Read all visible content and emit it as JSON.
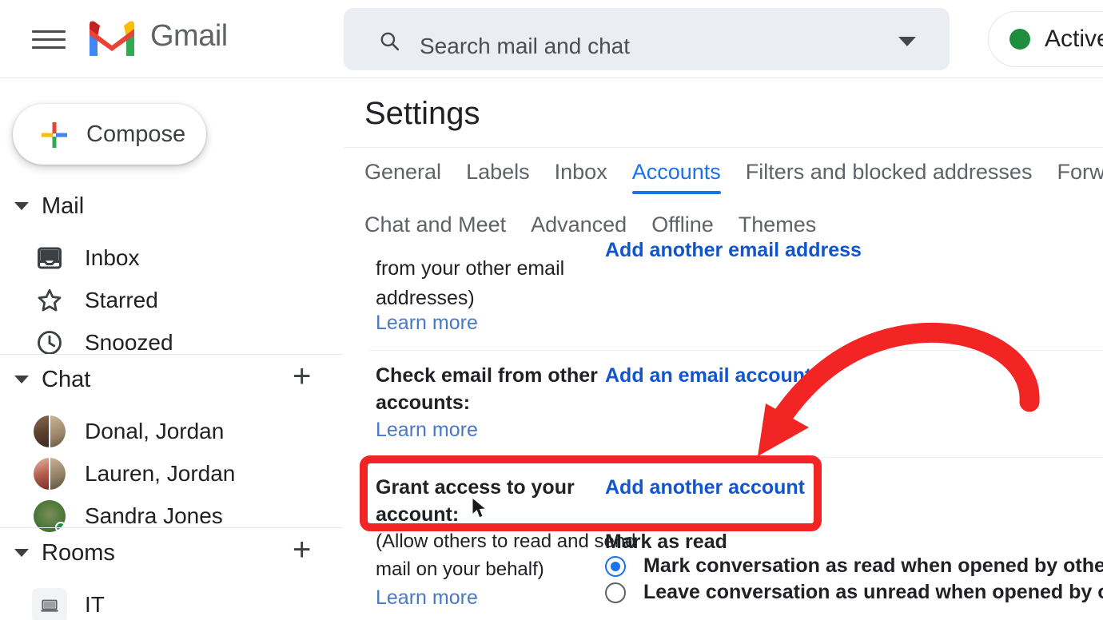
{
  "app": {
    "name": "Gmail"
  },
  "topbar": {
    "menu_icon": "hamburger-menu-icon",
    "logo_icon": "gmail-logo-icon",
    "brand": "Gmail",
    "search": {
      "icon": "search-icon",
      "placeholder": "Search mail and chat",
      "value": "",
      "options_icon": "chevron-down-icon"
    },
    "status": {
      "label": "Active",
      "dot_color": "#1e8e3e",
      "chevron": "chevron-down-icon"
    }
  },
  "sidebar": {
    "compose": {
      "label": "Compose",
      "icon": "plus-icon"
    },
    "groups": [
      {
        "label": "Mail",
        "caret": "caret-down-icon",
        "items": [
          {
            "label": "Inbox",
            "icon": "inbox-icon"
          },
          {
            "label": "Starred",
            "icon": "star-icon"
          },
          {
            "label": "Snoozed",
            "icon": "clock-icon"
          }
        ]
      },
      {
        "label": "Chat",
        "caret": "caret-down-icon",
        "add": "+",
        "items": [
          {
            "label": "Donal, Jordan",
            "icon": "avatar-group"
          },
          {
            "label": "Lauren, Jordan",
            "icon": "avatar-group"
          },
          {
            "label": "Sandra Jones",
            "icon": "avatar"
          }
        ]
      },
      {
        "label": "Rooms",
        "caret": "caret-down-icon",
        "add": "+",
        "items": [
          {
            "label": "IT",
            "icon": "laptop-icon"
          }
        ]
      }
    ]
  },
  "main": {
    "title": "Settings",
    "tabs_row1": [
      {
        "label": "General",
        "active": false
      },
      {
        "label": "Labels",
        "active": false
      },
      {
        "label": "Inbox",
        "active": false
      },
      {
        "label": "Accounts",
        "active": true
      },
      {
        "label": "Filters and blocked addresses",
        "active": false
      },
      {
        "label": "Forwarding",
        "active": false
      }
    ],
    "tabs_row2": [
      {
        "label": "Chat and Meet",
        "active": false
      },
      {
        "label": "Advanced",
        "active": false
      },
      {
        "label": "Offline",
        "active": false
      },
      {
        "label": "Themes",
        "active": false
      }
    ],
    "sections": {
      "send_mail_as": {
        "desc_line1": "from your other email",
        "desc_line2": "addresses)",
        "learn_more": "Learn more",
        "action": "Add another email address"
      },
      "check_email": {
        "label_line1": "Check email from other",
        "label_line2": "accounts:",
        "learn_more": "Learn more",
        "action": "Add an email account"
      },
      "grant_access": {
        "label_line1": "Grant access to your",
        "label_line2": "account:",
        "action": "Add another account",
        "desc_line1": "(Allow others to read and send",
        "desc_line2": "mail on your behalf)",
        "learn_more": "Learn more",
        "mark_as_read_title": "Mark as read",
        "options": [
          {
            "label": "Mark conversation as read when opened by others",
            "selected": true
          },
          {
            "label": "Leave conversation as unread when opened by others",
            "selected": false
          }
        ]
      }
    }
  },
  "annotations": {
    "highlight_color": "#f22424",
    "arrow_color": "#f22424",
    "highlight_target": "grant-access-row",
    "cursor": "mouse-pointer"
  }
}
